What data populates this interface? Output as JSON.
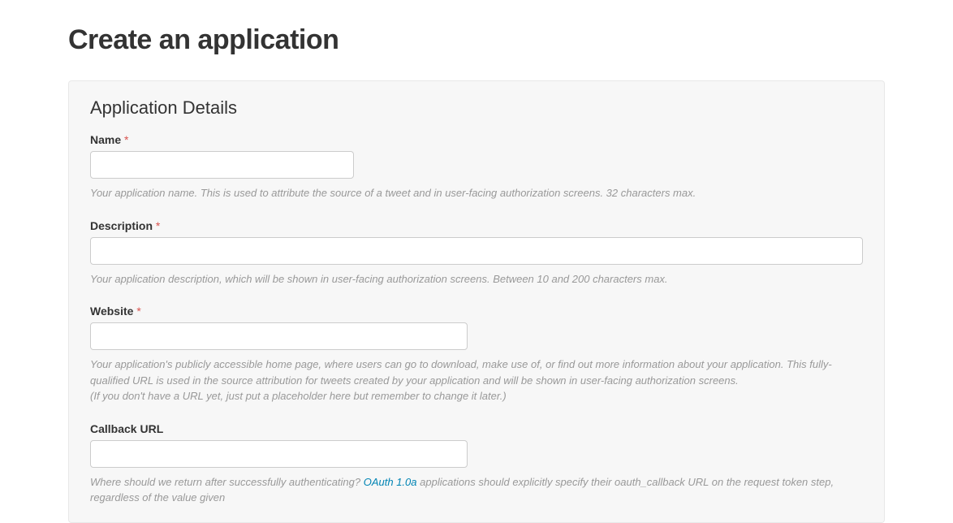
{
  "page": {
    "title": "Create an application"
  },
  "section": {
    "title": "Application Details"
  },
  "fields": {
    "name": {
      "label": "Name",
      "required": "*",
      "value": "",
      "help": "Your application name. This is used to attribute the source of a tweet and in user-facing authorization screens. 32 characters max."
    },
    "description": {
      "label": "Description",
      "required": "*",
      "value": "",
      "help": "Your application description, which will be shown in user-facing authorization screens. Between 10 and 200 characters max."
    },
    "website": {
      "label": "Website",
      "required": "*",
      "value": "",
      "help1": "Your application's publicly accessible home page, where users can go to download, make use of, or find out more information about your application. This fully-qualified URL is used in the source attribution for tweets created by your application and will be shown in user-facing authorization screens.",
      "help2": "(If you don't have a URL yet, just put a placeholder here but remember to change it later.)"
    },
    "callback": {
      "label": "Callback URL",
      "value": "",
      "help_pre": "Where should we return after successfully authenticating? ",
      "oauth_link": "OAuth 1.0a",
      "help_post": " applications should explicitly specify their oauth_callback URL on the request token step, regardless of the value given"
    }
  }
}
